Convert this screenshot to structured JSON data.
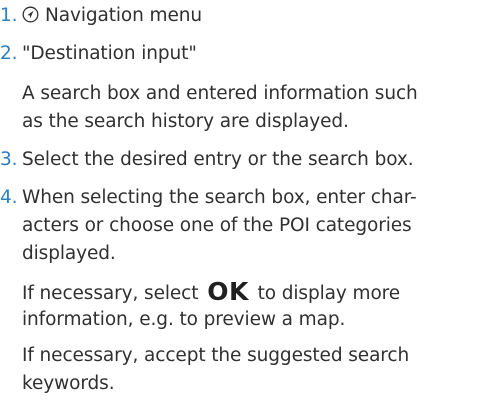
{
  "steps": [
    {
      "number": "1.",
      "icon": "navigation-arrow-icon",
      "text": "Navigation menu"
    },
    {
      "number": "2.",
      "text": "\"Destination input\""
    },
    {
      "number": "3.",
      "text": "Select the desired entry or the search box."
    },
    {
      "number": "4.",
      "lines": [
        "When selecting the search box, enter char-",
        "acters or choose one of the POI categories",
        "displayed."
      ]
    }
  ],
  "notes": {
    "step2_info": [
      "A search box and entered information such",
      "as the search history are displayed."
    ],
    "ok_before": "If necessary, select",
    "ok_label": "OK",
    "ok_after": "to display more",
    "ok_line2": "information, e.g. to preview a map.",
    "keywords": [
      "If necessary, accept the suggested search",
      "keywords."
    ]
  },
  "colors": {
    "step_number": "#2b7fc3",
    "body_text": "#303030"
  }
}
